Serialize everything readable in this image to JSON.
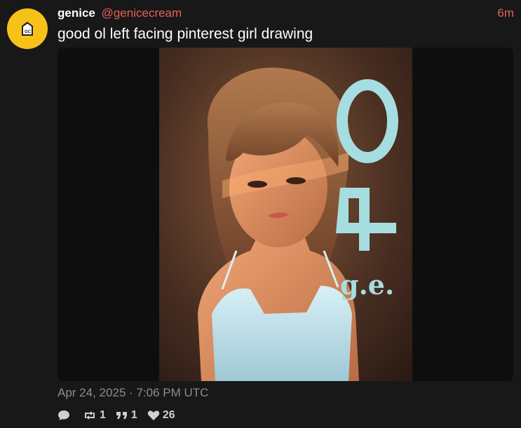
{
  "post": {
    "display_name": "genice",
    "handle": "@genicecream",
    "time_ago": "6m",
    "text": "good ol left facing pinterest girl drawing",
    "artwork_signature": "g.e.",
    "artwork_number": "04",
    "date": "Apr 24, 2025 · 7:06 PM UTC",
    "stats": {
      "replies": "",
      "reposts": "1",
      "quotes": "1",
      "likes": "26"
    }
  },
  "colors": {
    "accent": "#e5605b",
    "avatar_bg": "#f6c21a",
    "background": "#181818",
    "muted": "#8c8c8c"
  },
  "icons": {
    "avatar": "milk-carton-icon",
    "reply": "speech-bubble-icon",
    "repost": "repost-arrows-icon",
    "quote": "quote-marks-icon",
    "like": "heart-icon"
  }
}
